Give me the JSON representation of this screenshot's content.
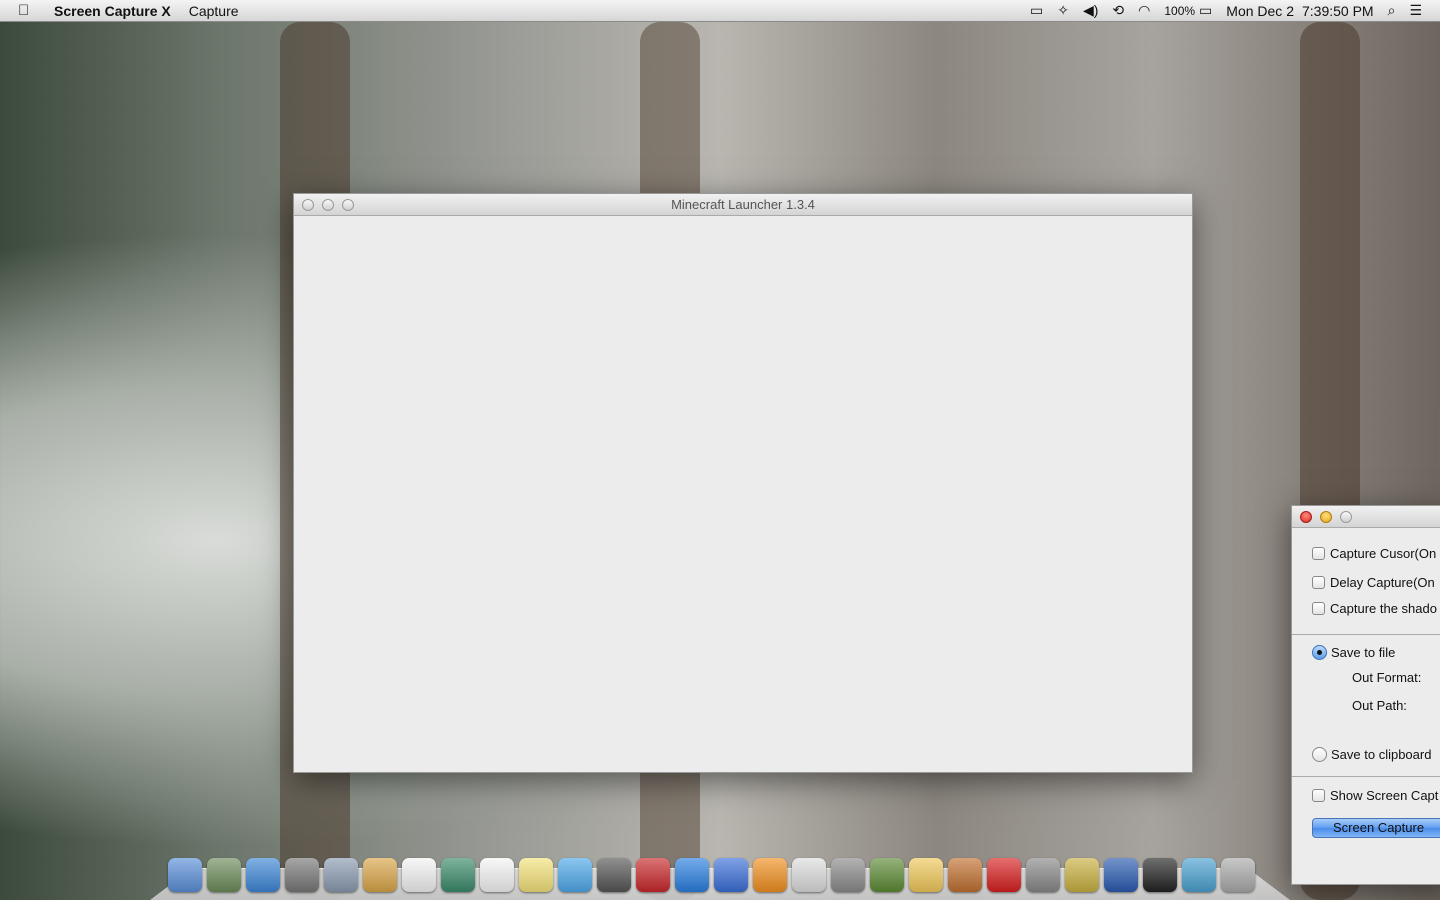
{
  "menubar": {
    "app_name": "Screen Capture X",
    "menus": [
      "Capture"
    ],
    "battery": "100%",
    "date": "Mon Dec 2",
    "time": "7:39:50 PM"
  },
  "minecraft_window": {
    "title": "Minecraft Launcher 1.3.4"
  },
  "capture_window": {
    "checkboxes": [
      "Capture Cusor(On",
      "Delay Capture(On",
      "Capture the shado"
    ],
    "save_to_file": "Save to file",
    "out_format": "Out Format:",
    "out_path": "Out Path:",
    "save_to_clipboard": "Save to clipboard",
    "show_screen_capture": "Show Screen Capt",
    "capture_button": "Screen Capture"
  },
  "dock": {
    "icons": [
      "finder",
      "preview",
      "safari",
      "launchpad",
      "mail",
      "contacts",
      "calendar",
      "iphoto",
      "reminders",
      "notes",
      "messages",
      "facetime",
      "photo-booth",
      "app-store",
      "itunes",
      "ibooks",
      "maps",
      "system-preferences",
      "minecraft",
      "textedit",
      "game",
      "skitch-pro",
      "gta-san-andreas",
      "racing-game",
      "f1",
      "ball-game",
      "screen-sharing",
      "trash"
    ],
    "colors": [
      "#5a8fd8",
      "#6d8c5a",
      "#3d86d6",
      "#777",
      "#8a9bb0",
      "#d9a548",
      "#f2f2f2",
      "#3a8a6a",
      "#f4f4f4",
      "#f3e27a",
      "#4ea8ea",
      "#555",
      "#c8282a",
      "#2a7fe0",
      "#3b6fd8",
      "#f09020",
      "#dcdcdc",
      "#8a8a8a",
      "#5c8a34",
      "#f0c85a",
      "#c07030",
      "#d82020",
      "#888",
      "#c8b040",
      "#2a5ab0",
      "#222",
      "#4aa0d0",
      "#aaa"
    ]
  }
}
